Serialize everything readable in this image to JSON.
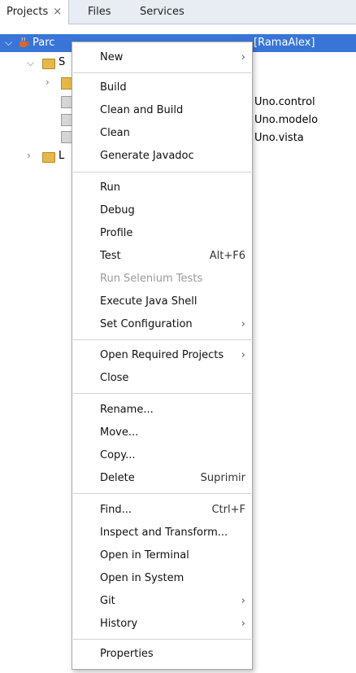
{
  "tabs": [
    {
      "label": "Projects",
      "close": "×"
    },
    {
      "label": "Files"
    },
    {
      "label": "Services"
    }
  ],
  "tree": {
    "selected_left": "Parc",
    "selected_right": "[RamaAlex]",
    "packages": [
      "Uno.control",
      "Uno.modelo",
      "Uno.vista"
    ],
    "row_s": "S",
    "row_l": "L"
  },
  "menu": {
    "new": "New",
    "build": "Build",
    "clean_build": "Clean and Build",
    "clean": "Clean",
    "javadoc": "Generate Javadoc",
    "run": "Run",
    "debug": "Debug",
    "profile": "Profile",
    "test": "Test",
    "test_shortcut": "Alt+F6",
    "run_selenium": "Run Selenium Tests",
    "java_shell": "Execute Java Shell",
    "set_config": "Set Configuration",
    "open_required": "Open Required Projects",
    "close": "Close",
    "rename": "Rename...",
    "move": "Move...",
    "copy": "Copy...",
    "delete": "Delete",
    "delete_shortcut": "Suprimir",
    "find": "Find...",
    "find_shortcut": "Ctrl+F",
    "inspect": "Inspect and Transform...",
    "open_terminal": "Open in Terminal",
    "open_system": "Open in System",
    "git": "Git",
    "history": "History",
    "properties": "Properties",
    "submenu_arrow": "›"
  },
  "colors": {
    "selection": "#3875d7",
    "tabbar": "#e8ecf3"
  }
}
